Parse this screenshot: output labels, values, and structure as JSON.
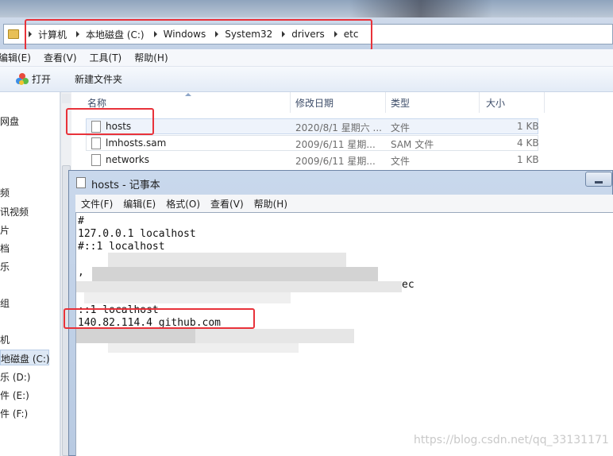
{
  "explorer": {
    "breadcrumb": [
      "计算机",
      "本地磁盘 (C:)",
      "Windows",
      "System32",
      "drivers",
      "etc"
    ],
    "menu": [
      "编辑(E)",
      "查看(V)",
      "工具(T)",
      "帮助(H)"
    ],
    "toolbar": {
      "open_label": "打开",
      "new_folder_label": "新建文件夹"
    },
    "nav_items": [
      "网盘",
      "",
      "频",
      "讯视频",
      "片",
      "档",
      "乐",
      "组",
      "机",
      "地磁盘 (C:)",
      "乐 (D:)",
      "件 (E:)",
      "件 (F:)"
    ],
    "columns": {
      "name": "名称",
      "modified": "修改日期",
      "type": "类型",
      "size": "大小"
    },
    "files": [
      {
        "name": "hosts",
        "modified": "2020/8/1 星期六 ...",
        "type": "文件",
        "size": "1 KB"
      },
      {
        "name": "lmhosts.sam",
        "modified": "2009/6/11 星期...",
        "type": "SAM 文件",
        "size": "4 KB"
      },
      {
        "name": "networks",
        "modified": "2009/6/11 星期...",
        "type": "文件",
        "size": "1 KB"
      }
    ]
  },
  "notepad": {
    "title": "hosts - 记事本",
    "menu": [
      "文件(F)",
      "编辑(E)",
      "格式(O)",
      "查看(V)",
      "帮助(H)"
    ],
    "lines": [
      "#",
      "127.0.0.1 localhost",
      "#::1 localhost",
      "",
      "",
      "::1 localhost",
      "140.82.114.4 github.com"
    ],
    "partial_text": "ec",
    "partial_text_left": ","
  },
  "watermark": "https://blog.csdn.net/qq_33131171",
  "colors": {
    "highlight_red": "#e8323a",
    "selection": "#eef3fb"
  }
}
